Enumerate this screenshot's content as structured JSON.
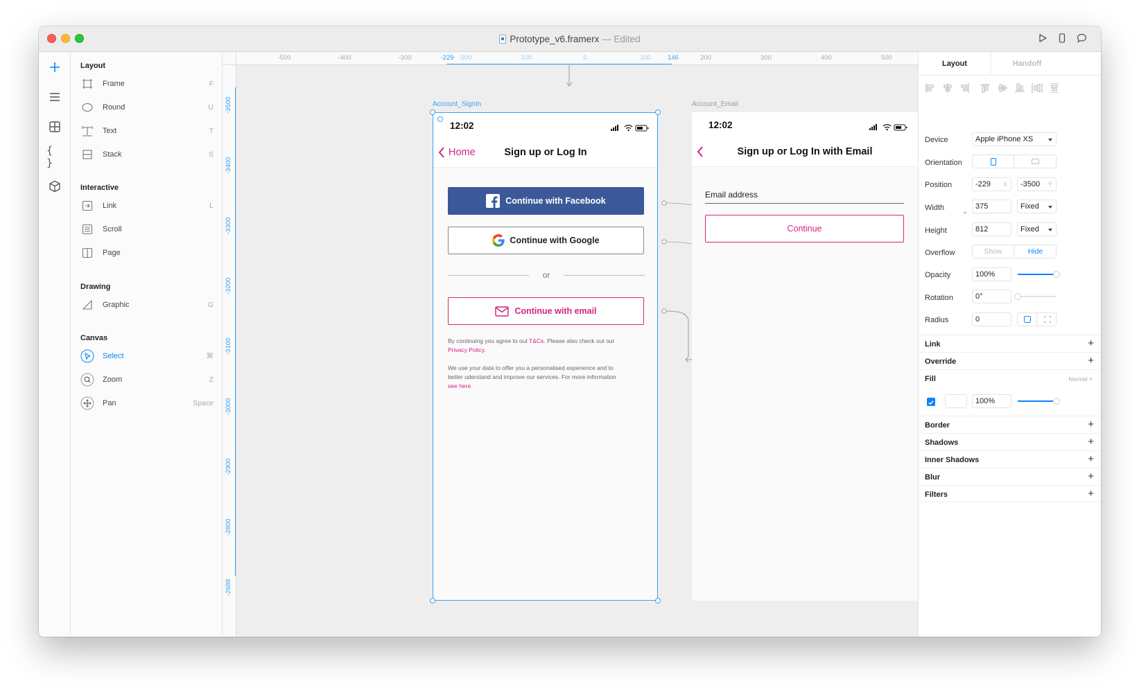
{
  "window": {
    "file_name": "Prototype_v6.framerx",
    "edited_label": "— Edited"
  },
  "insert_panel": {
    "sections": {
      "layout": "Layout",
      "interactive": "Interactive",
      "drawing": "Drawing",
      "canvas": "Canvas"
    },
    "layout_items": [
      {
        "label": "Frame",
        "key": "F"
      },
      {
        "label": "Round",
        "key": "U"
      },
      {
        "label": "Text",
        "key": "T"
      },
      {
        "label": "Stack",
        "key": "S"
      }
    ],
    "interactive_items": [
      {
        "label": "Link",
        "key": "L"
      },
      {
        "label": "Scroll",
        "key": ""
      },
      {
        "label": "Page",
        "key": ""
      }
    ],
    "drawing_items": [
      {
        "label": "Graphic",
        "key": "G"
      }
    ],
    "canvas_items": [
      {
        "label": "Select",
        "key": "⌘"
      },
      {
        "label": "Zoom",
        "key": "Z"
      },
      {
        "label": "Pan",
        "key": "Space"
      }
    ]
  },
  "rulers": {
    "top": [
      "-500",
      "-400",
      "-300",
      "-229",
      "-200",
      "-100",
      "0",
      "100",
      "146",
      "200",
      "300",
      "400",
      "500"
    ],
    "left": [
      "-3500",
      "-3400",
      "-3300",
      "-3200",
      "-3100",
      "-3000",
      "-2900",
      "-2800",
      "-2688"
    ]
  },
  "signin_frame": {
    "name": "Account_SignIn",
    "time": "12:02",
    "back_label": "Home",
    "title": "Sign up or Log In",
    "facebook_label": "Continue with Facebook",
    "google_label": "Continue with Google",
    "divider_label": "or",
    "email_label": "Continue with email",
    "terms_pre": "By continuing you agree to out ",
    "terms_link": "T&Cs",
    "terms_mid": ". Please also check out our",
    "privacy_link": "Privacy Policy",
    "terms_end": ".",
    "data_text_1": "We use your data to offer you a personalised experience and to",
    "data_text_2": "better uderstand and improve our services. For more information",
    "see_here": "see here",
    "see_here_end": "."
  },
  "email_frame": {
    "name": "Account_Email",
    "time": "12:02",
    "title": "Sign up or Log In with Email",
    "field_label": "Email address",
    "continue_label": "Continue"
  },
  "props": {
    "tabs": [
      "Layout",
      "Handoff"
    ],
    "device_label": "Device",
    "device_value": "Apple iPhone XS",
    "orientation_label": "Orientation",
    "position_label": "Position",
    "position_x": "-229",
    "position_x_suffix": "X",
    "position_y": "-3500",
    "position_y_suffix": "Y",
    "width_label": "Width",
    "width_value": "375",
    "width_mode": "Fixed",
    "height_label": "Height",
    "height_value": "812",
    "height_mode": "Fixed",
    "overflow_label": "Overflow",
    "overflow_show": "Show",
    "overflow_hide": "Hide",
    "opacity_label": "Opacity",
    "opacity_value": "100%",
    "opacity_level": 1.0,
    "rotation_label": "Rotation",
    "rotation_value": "0°",
    "rotation_level": 0.0,
    "radius_label": "Radius",
    "radius_value": "0",
    "link_label": "Link",
    "override_label": "Override",
    "fill_label": "Fill",
    "fill_mode": "Normal",
    "fill_opacity": "100%",
    "fill_level": 1.0,
    "border_label": "Border",
    "shadows_label": "Shadows",
    "inner_shadows_label": "Inner Shadows",
    "blur_label": "Blur",
    "filters_label": "Filters"
  },
  "colors": {
    "accent": "#0a84ff",
    "ruler_blue": "#39a0f0",
    "facebook": "#3b5998",
    "pink": "#d6237f"
  }
}
